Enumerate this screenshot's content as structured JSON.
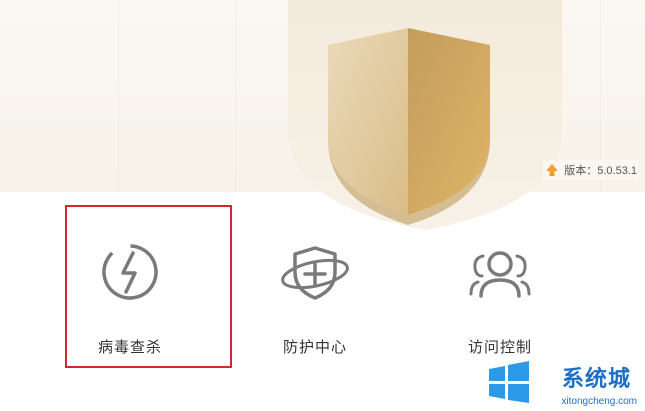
{
  "header": {
    "version_label": "版本：5.0.53.1"
  },
  "features": [
    {
      "label": "病毒查杀",
      "icon": "lightning-icon"
    },
    {
      "label": "防护中心",
      "icon": "shield-plus-icon"
    },
    {
      "label": "访问控制",
      "icon": "users-icon"
    }
  ],
  "watermark": {
    "title": "系统城",
    "url": "xitongcheng.com"
  },
  "colors": {
    "accent_gold": "#c9a05a",
    "highlight_red": "#d8262a",
    "icon_gray": "#7a7a7a",
    "watermark_blue": "#1e6fc8"
  }
}
